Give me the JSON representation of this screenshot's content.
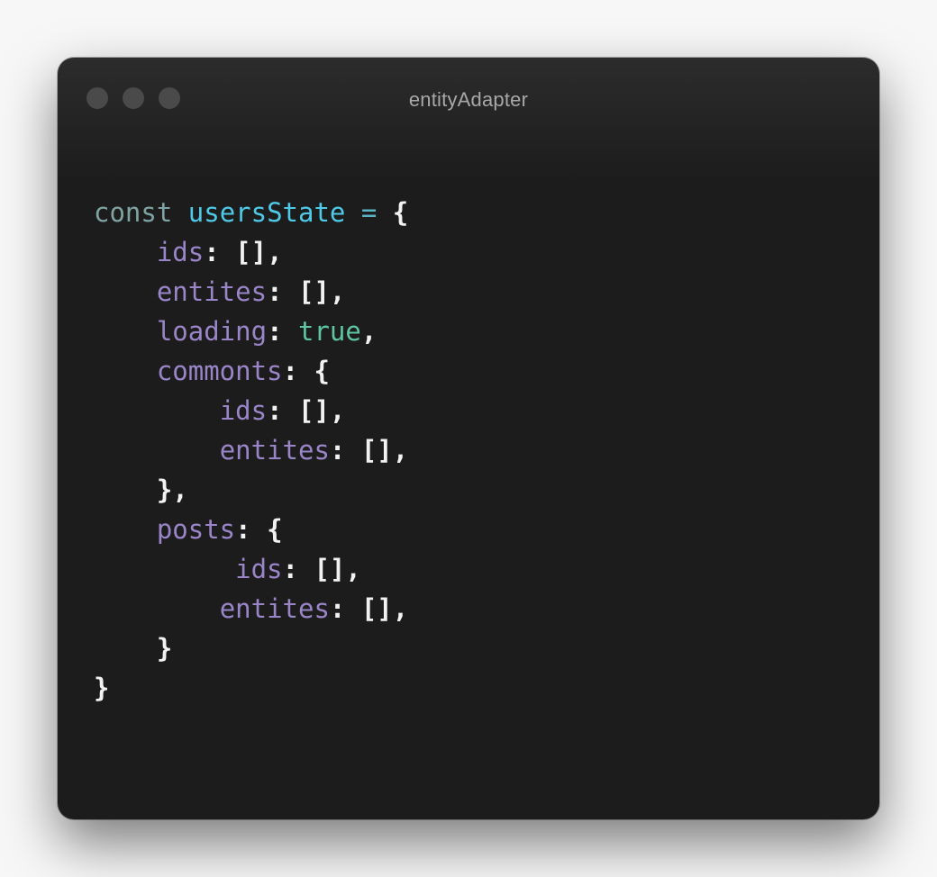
{
  "window": {
    "title": "entityAdapter",
    "dot_color": "#4a4a4a",
    "background": "#1c1c1c"
  },
  "code": {
    "keyword": "const",
    "variable": "usersState",
    "operator": "=",
    "open_brace": "{",
    "close_brace": "}",
    "root_keys": {
      "ids": "ids",
      "entities": "entites",
      "loading": "loading",
      "loading_value": "true",
      "comments": "commonts",
      "posts": "posts"
    },
    "comments_keys": {
      "ids": "ids",
      "entities": "entites"
    },
    "posts_keys": {
      "ids": "ids",
      "entities": "entites"
    },
    "empty_array": "[]"
  },
  "colors": {
    "keyword": "#7fa3a2",
    "variable": "#4fc9e8",
    "property": "#9985c8",
    "boolean": "#5fc4a3",
    "punctuation": "#f2f2f2"
  }
}
